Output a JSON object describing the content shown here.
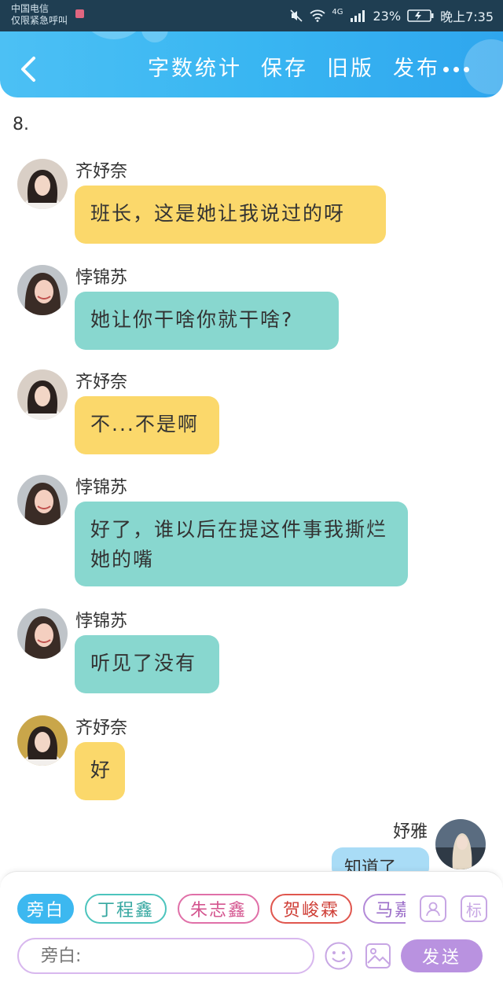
{
  "status_bar": {
    "carrier_line1": "中国电信",
    "carrier_line2": "仅限紧急呼叫",
    "network": "4G",
    "battery_percent": "23%",
    "time": "晚上7:35"
  },
  "header": {
    "back_icon": "chevron-left-icon",
    "actions": [
      "字数统计",
      "保存",
      "旧版",
      "发布"
    ],
    "more_icon": "more-dots-icon"
  },
  "chapter_label": "8.",
  "messages": [
    {
      "name": "齐妤奈",
      "text": "班长，这是她让我说过的呀",
      "color": "#fbd86b"
    },
    {
      "name": "悖锦苏",
      "text": "她让你干啥你就干啥?",
      "color": "#88d7cf"
    },
    {
      "name": "齐妤奈",
      "text": "不...不是啊",
      "color": "#fbd86b"
    },
    {
      "name": "悖锦苏",
      "text": "好了，谁以后在提这件事我撕烂她的嘴",
      "color": "#88d7cf"
    },
    {
      "name": "悖锦苏",
      "text": "听见了没有",
      "color": "#88d7cf"
    },
    {
      "name": "齐妤奈",
      "text": "好",
      "color": "#fbd86b"
    }
  ],
  "self_message": {
    "name": "妤雅",
    "text": "知道了",
    "color": "#a9dcf6"
  },
  "composer": {
    "roles": [
      {
        "label": "旁白",
        "color": "#3cb8f0",
        "active": true
      },
      {
        "label": "丁程鑫",
        "color": "#4cc4bd",
        "active": false
      },
      {
        "label": "朱志鑫",
        "color": "#e070a8",
        "active": false
      },
      {
        "label": "贺峻霖",
        "color": "#e0564e",
        "active": false
      },
      {
        "label": "马嘉祺",
        "color": "#b38ad8",
        "active": false
      }
    ],
    "role_icon": "person-icon",
    "tag_label": "标",
    "input_placeholder": "旁白:",
    "emoji_icon": "smiley-icon",
    "image_icon": "image-icon",
    "send_label": "发送"
  }
}
